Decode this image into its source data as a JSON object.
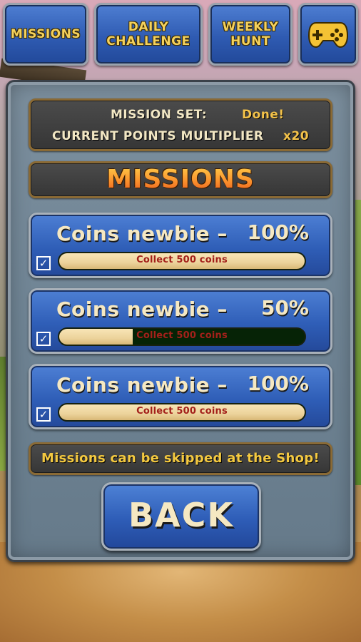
{
  "tabs": [
    {
      "label": "MISSIONS"
    },
    {
      "label": "DAILY\nCHALLENGE"
    },
    {
      "label": "WEEKLY\nHUNT"
    },
    {
      "icon": "gamepad-icon"
    }
  ],
  "info": {
    "mission_set_label": "MISSION SET:",
    "mission_set_value": "Done!",
    "multiplier_label": "CURRENT POINTS MULTIPLIER",
    "multiplier_value": "x20"
  },
  "title": "MISSIONS",
  "missions": [
    {
      "name": "Coins newbie –",
      "percent": "100%",
      "progress": 1.0,
      "task": "Collect 500 coins",
      "checked": true
    },
    {
      "name": "Coins newbie –",
      "percent": "50%",
      "progress": 0.3,
      "task": "Collect 500 coins",
      "checked": true
    },
    {
      "name": "Coins newbie –",
      "percent": "100%",
      "progress": 1.0,
      "task": "Collect 500 coins",
      "checked": true
    }
  ],
  "note": "Missions can be skipped at the Shop!",
  "back_label": "BACK",
  "colors": {
    "accent_yellow": "#f4c940",
    "button_blue": "#2f5eb7",
    "title_orange": "#f7903a",
    "task_red": "#a3201a"
  }
}
